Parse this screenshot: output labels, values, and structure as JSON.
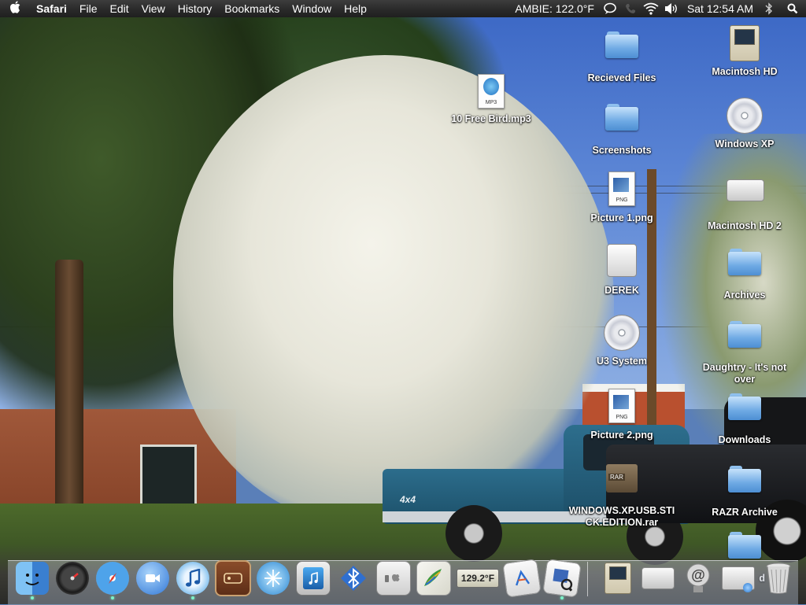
{
  "menubar": {
    "app_name": "Safari",
    "menus": [
      "File",
      "Edit",
      "View",
      "History",
      "Bookmarks",
      "Window",
      "Help"
    ],
    "status": {
      "ambie": "AMBIE: 122.0°F",
      "clock": "Sat 12:54 AM"
    }
  },
  "desktop": {
    "icons": [
      {
        "label": "10 Free Bird.mp3",
        "kind": "mp3-file",
        "ext": "MP3"
      },
      {
        "label": "Recieved Files",
        "kind": "folder"
      },
      {
        "label": "Screenshots",
        "kind": "folder"
      },
      {
        "label": "Picture 1.png",
        "kind": "png-file",
        "ext": "PNG"
      },
      {
        "label": "DEREK",
        "kind": "usb-drive"
      },
      {
        "label": "U3 System",
        "kind": "cd-disc"
      },
      {
        "label": "Picture 2.png",
        "kind": "png-file",
        "ext": "PNG"
      },
      {
        "label": "WINDOWS.XP.USB.STICK.EDITION.rar",
        "kind": "rar-archive",
        "ext": "RAR"
      },
      {
        "label": "Macintosh HD",
        "kind": "hard-drive"
      },
      {
        "label": "Windows XP",
        "kind": "cd-disc"
      },
      {
        "label": "Macintosh HD 2",
        "kind": "hard-drive"
      },
      {
        "label": "Archives",
        "kind": "folder"
      },
      {
        "label": "Daughtry - It's not over",
        "kind": "folder"
      },
      {
        "label": "Downloads",
        "kind": "folder"
      },
      {
        "label": "RAZR Archive",
        "kind": "folder"
      },
      {
        "label": "d",
        "kind": "folder"
      }
    ]
  },
  "wallpaper": {
    "truck_badge": "4x4"
  },
  "dock": {
    "temp_widget": "129.2°F",
    "items": [
      {
        "name": "finder",
        "icon": "finder-icon",
        "running": true
      },
      {
        "name": "dashboard",
        "icon": "dashboard-icon",
        "running": false
      },
      {
        "name": "safari",
        "icon": "safari-icon",
        "running": true
      },
      {
        "name": "ichat",
        "icon": "ichat-icon",
        "running": false
      },
      {
        "name": "itunes",
        "icon": "itunes-icon",
        "running": true
      },
      {
        "name": "photo-booth",
        "icon": "photo-booth-icon",
        "running": false
      },
      {
        "name": "network-utility",
        "icon": "network-icon",
        "running": false
      },
      {
        "name": "ipod",
        "icon": "ipod-icon",
        "running": false
      },
      {
        "name": "bluetooth",
        "icon": "bluetooth-icon",
        "running": false
      },
      {
        "name": "system-profiler",
        "icon": "apple-switch-icon",
        "running": false
      },
      {
        "name": "bird-app",
        "icon": "bird-icon",
        "running": false
      },
      {
        "name": "temperature-monitor",
        "icon": "thermometer-icon",
        "running": false
      },
      {
        "name": "applications-folder",
        "icon": "applications-icon",
        "running": false
      },
      {
        "name": "preview",
        "icon": "preview-icon",
        "running": true
      }
    ],
    "right_items": [
      {
        "name": "macintosh-hd",
        "icon": "mac-hd-icon"
      },
      {
        "name": "external-drive",
        "icon": "hard-drive-icon"
      },
      {
        "name": "mail-stack",
        "icon": "at-icon"
      },
      {
        "name": "network-stack",
        "icon": "network-drive-icon"
      },
      {
        "name": "trash",
        "icon": "trash-icon"
      }
    ]
  },
  "colors": {
    "menubar": "#2a2a2a",
    "folder_blue": "#6ea9e4",
    "label_text": "#ffffff"
  }
}
